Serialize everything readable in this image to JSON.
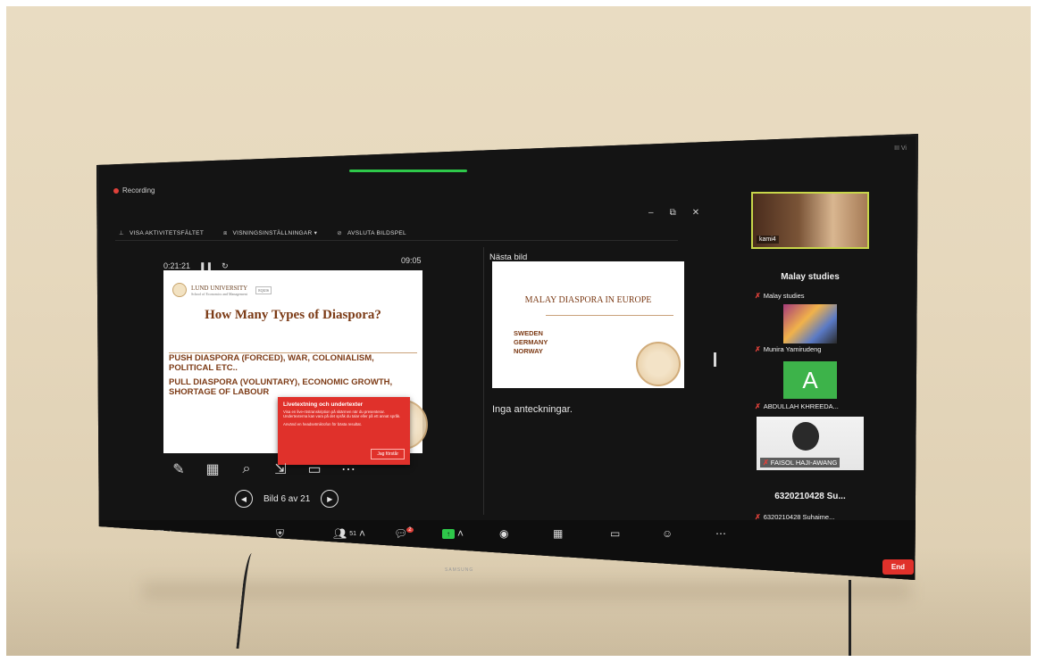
{
  "recording": {
    "label": "Recording"
  },
  "corner": {
    "label": "III Vi"
  },
  "toolbar": {
    "items": [
      {
        "label": "VISA AKTIVITETSFÄLTET"
      },
      {
        "label": "VISNINGSINSTÄLLNINGAR ▾"
      },
      {
        "label": "AVSLUTA BILDSPEL"
      }
    ],
    "window_controls": [
      "–",
      "⧉",
      "✕"
    ]
  },
  "presenter": {
    "elapsed": "0:21:21",
    "clock": "09:05",
    "slide": {
      "logo_text": "LUND UNIVERSITY",
      "logo_sub": "School of Economics and Management",
      "logo_badge": "EQUIS",
      "title": "How Many Types of Diaspora?",
      "point1": "PUSH DIASPORA (FORCED), WAR, COLONIALISM, POLITICAL ETC..",
      "point2": "PULL DIASPORA (VOLUNTARY), ECONOMIC GROWTH, SHORTAGE OF LABOUR"
    },
    "nav_label": "Bild 6 av 21",
    "notes": "Inga anteckningar."
  },
  "popup": {
    "title": "Livetextning och undertexter",
    "body": "Visa en live-röstranskription på skärmen när du presenterar. Undertexterna kan vara på det språk du talar eller på ett annat språk.",
    "body2": "Använd en headsetmikrofon för bästa resultat.",
    "button": "Jag förstår"
  },
  "next": {
    "label": "Nästa bild",
    "title": "MALAY DIASPORA IN EUROPE",
    "items": [
      "SWEDEN",
      "GERMANY",
      "NORWAY"
    ]
  },
  "gallery": {
    "main_name": "kami4",
    "heading": "Malay studies",
    "participants": [
      {
        "name": "Malay studies"
      },
      {
        "name": "Munira Yamirudeng"
      },
      {
        "name": "ABDULLAH KHREEDA...",
        "initial": "A"
      },
      {
        "name": "FAISOL HAJI-AWANG"
      },
      {
        "name": "6320210428 Suhaime...",
        "heading": "6320210428 Su..."
      }
    ]
  },
  "bottom": {
    "participants_count": "51",
    "chat_badge": "2",
    "share_badge": "↑",
    "end_label": "End"
  },
  "tv": {
    "brand": "SAMSUNG"
  },
  "colors": {
    "accent_green": "#2ec84a",
    "end_red": "#e0312b",
    "speaker_border": "#c8d64a"
  }
}
